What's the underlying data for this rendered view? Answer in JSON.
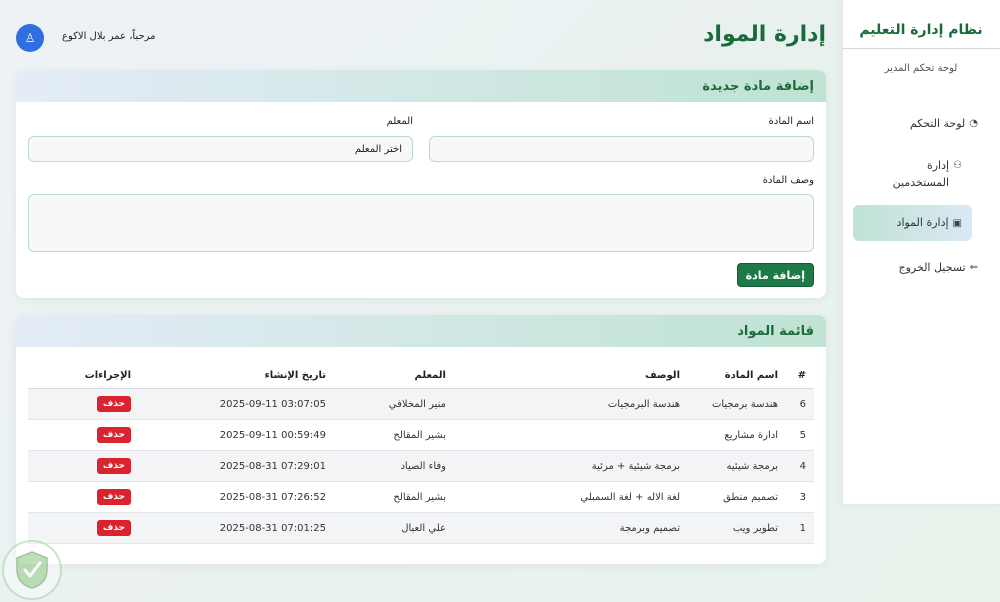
{
  "sidebar": {
    "title": "نظام إدارة التعليم",
    "subtitle": "لوحة تحكم المدير",
    "items": [
      {
        "label": "لوحة التحكم",
        "icon": "dashboard-icon"
      },
      {
        "label": "إدارة المستخدمين",
        "icon": "users-icon"
      },
      {
        "label": "إدارة المواد",
        "icon": "book-icon"
      },
      {
        "label": "تسجيل الخروج",
        "icon": "logout-icon"
      }
    ]
  },
  "header": {
    "title": "إدارة المواد",
    "welcome": "مرحباً، عمر بلال الاكوع"
  },
  "add_form": {
    "title": "إضافة مادة جديدة",
    "name_label": "اسم المادة",
    "teacher_label": "المعلم",
    "teacher_value": "اختر المعلم",
    "desc_label": "وصف المادة",
    "submit": "إضافة مادة"
  },
  "list": {
    "title": "قائمة المواد",
    "columns": [
      "#",
      "اسم المادة",
      "الوصف",
      "المعلم",
      "تاريخ الإنشاء",
      "الإجراءات"
    ],
    "delete_label": "حذف",
    "rows": [
      {
        "id": "6",
        "name": "هندسة برمجيات",
        "desc": "هندسة البرمجيات",
        "teacher": "منير المخلافي",
        "date": "2025-09-11 03:07:05"
      },
      {
        "id": "5",
        "name": "ادارة مشاريع",
        "desc": "",
        "teacher": "بشير المقالح",
        "date": "2025-09-11 00:59:49"
      },
      {
        "id": "4",
        "name": "برمجة شيئيه",
        "desc": "برمجة شيئية + مرئية",
        "teacher": "وفاء الصياد",
        "date": "2025-08-31 07:29:01"
      },
      {
        "id": "3",
        "name": "تصميم منطق",
        "desc": "لغة الاله + لغة السمبلي",
        "teacher": "بشير المقالح",
        "date": "2025-08-31 07:26:52"
      },
      {
        "id": "1",
        "name": "تطوير ويب",
        "desc": "تصميم وبرمجة",
        "teacher": "علي العبال",
        "date": "2025-08-31 07:01:25"
      }
    ]
  },
  "colors": {
    "brand": "#1a6b3c",
    "danger": "#d9242f",
    "avatar": "#2f6fe0"
  }
}
